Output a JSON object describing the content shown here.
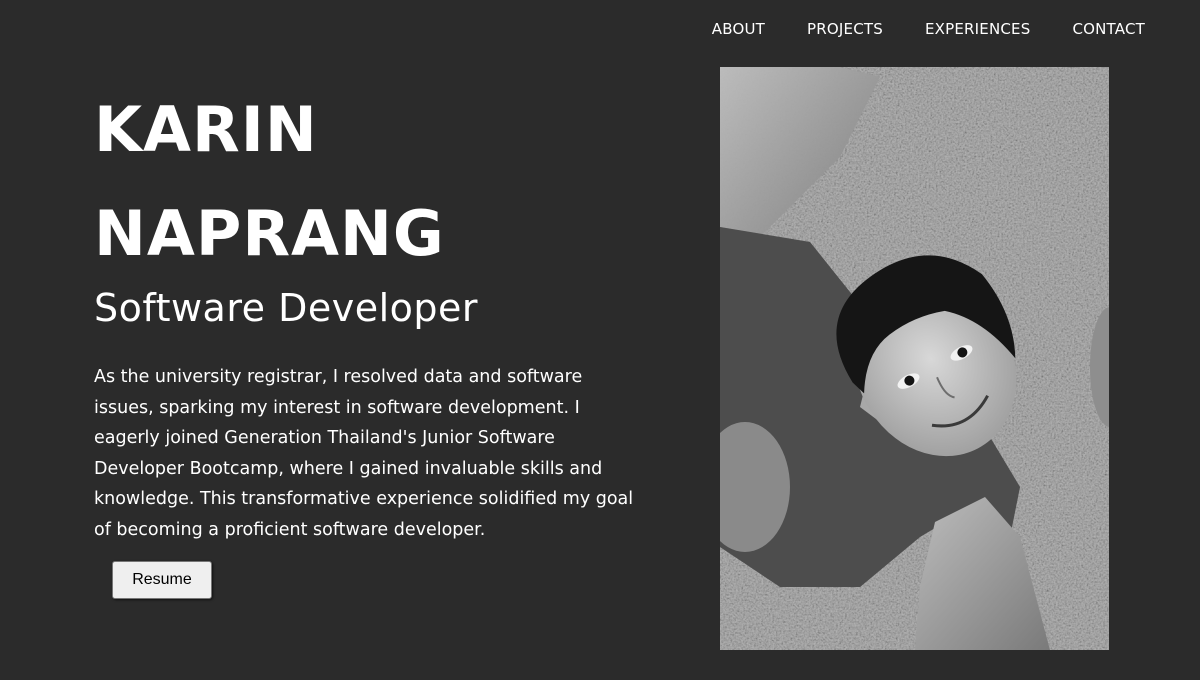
{
  "nav": {
    "items": [
      {
        "label": "ABOUT"
      },
      {
        "label": "PROJECTS"
      },
      {
        "label": "EXPERIENCES"
      },
      {
        "label": "CONTACT"
      }
    ]
  },
  "hero": {
    "first_name": "KARIN",
    "last_name": "NAPRANG",
    "role": "Software Developer",
    "bio": "As the university registrar, I resolved data and software issues, sparking my interest in software development. I eagerly joined Generation Thailand's Junior Software Developer Bootcamp, where I gained invaluable skills and knowledge. This transformative experience solidified my goal of becoming a proficient software developer.",
    "resume_label": "Resume"
  },
  "colors": {
    "background": "#2b2b2b",
    "text": "#ffffff",
    "button_bg": "#efefef"
  }
}
